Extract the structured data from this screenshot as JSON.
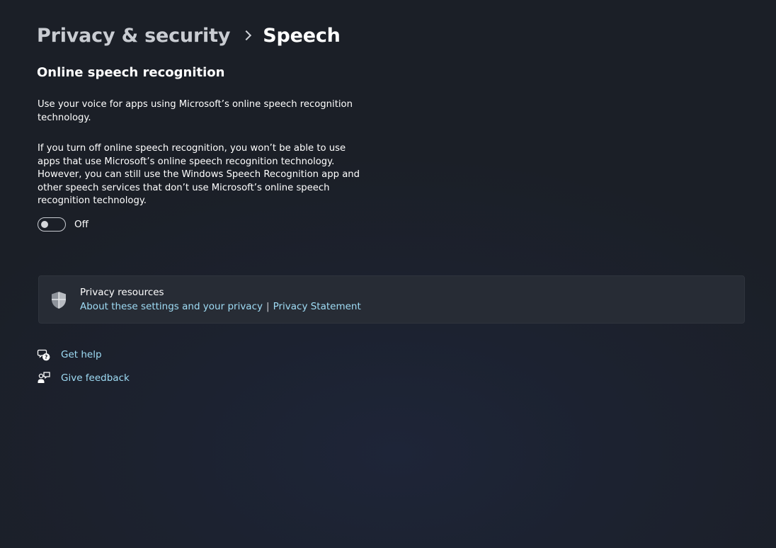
{
  "breadcrumb": {
    "parent": "Privacy & security",
    "current": "Speech"
  },
  "section": {
    "title": "Online speech recognition",
    "description1": "Use your voice for apps using Microsoft’s online speech recognition technology.",
    "description2": "If you turn off online speech recognition, you won’t be able to use apps that use Microsoft’s online speech recognition technology.  However, you can still use the Windows Speech Recognition app and other speech services that don’t use Microsoft’s online speech recognition technology.",
    "toggle": {
      "state": "off",
      "label": "Off"
    }
  },
  "privacy_resources": {
    "icon": "shield-icon",
    "title": "Privacy resources",
    "link1": "About these settings and your privacy",
    "separator": "|",
    "link2": "Privacy Statement"
  },
  "help": {
    "get_help": {
      "icon": "get-help-icon",
      "label": "Get help"
    },
    "give_feedback": {
      "icon": "feedback-icon",
      "label": "Give feedback"
    }
  },
  "colors": {
    "link": "#9fdcf5",
    "card": "#272c35",
    "background": "#1b1f27"
  }
}
